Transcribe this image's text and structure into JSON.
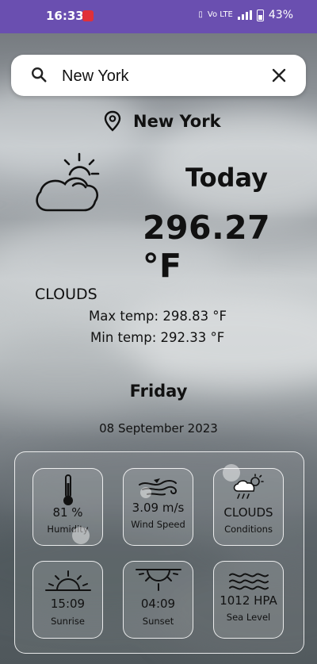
{
  "status_bar": {
    "time": "16:33",
    "battery": "43%",
    "signal_text": "Vo LTE"
  },
  "search": {
    "value": "New York",
    "placeholder": ""
  },
  "location": {
    "name": "New York"
  },
  "current": {
    "label": "Today",
    "temperature": "296.27 °F",
    "condition": "CLOUDS",
    "max_temp": "Max temp: 298.83 °F",
    "min_temp": "Min temp: 292.33 °F",
    "day": "Friday",
    "date": "08 September 2023"
  },
  "tiles": [
    {
      "value": "81 %",
      "label": "Humidity",
      "icon": "thermometer-icon"
    },
    {
      "value": "3.09 m/s",
      "label": "Wind Speed",
      "icon": "wind-icon"
    },
    {
      "value": "CLOUDS",
      "label": "Conditions",
      "icon": "cloud-sun-rain-icon"
    },
    {
      "value": "15:09",
      "label": "Sunrise",
      "icon": "sunrise-icon"
    },
    {
      "value": "04:09",
      "label": "Sunset",
      "icon": "sunset-icon"
    },
    {
      "value": "1012 HPA",
      "label": "Sea Level",
      "icon": "waves-icon"
    }
  ],
  "colors": {
    "status_bar": "#6a4fb0",
    "text": "#111111",
    "card_border": "#ffffff"
  }
}
